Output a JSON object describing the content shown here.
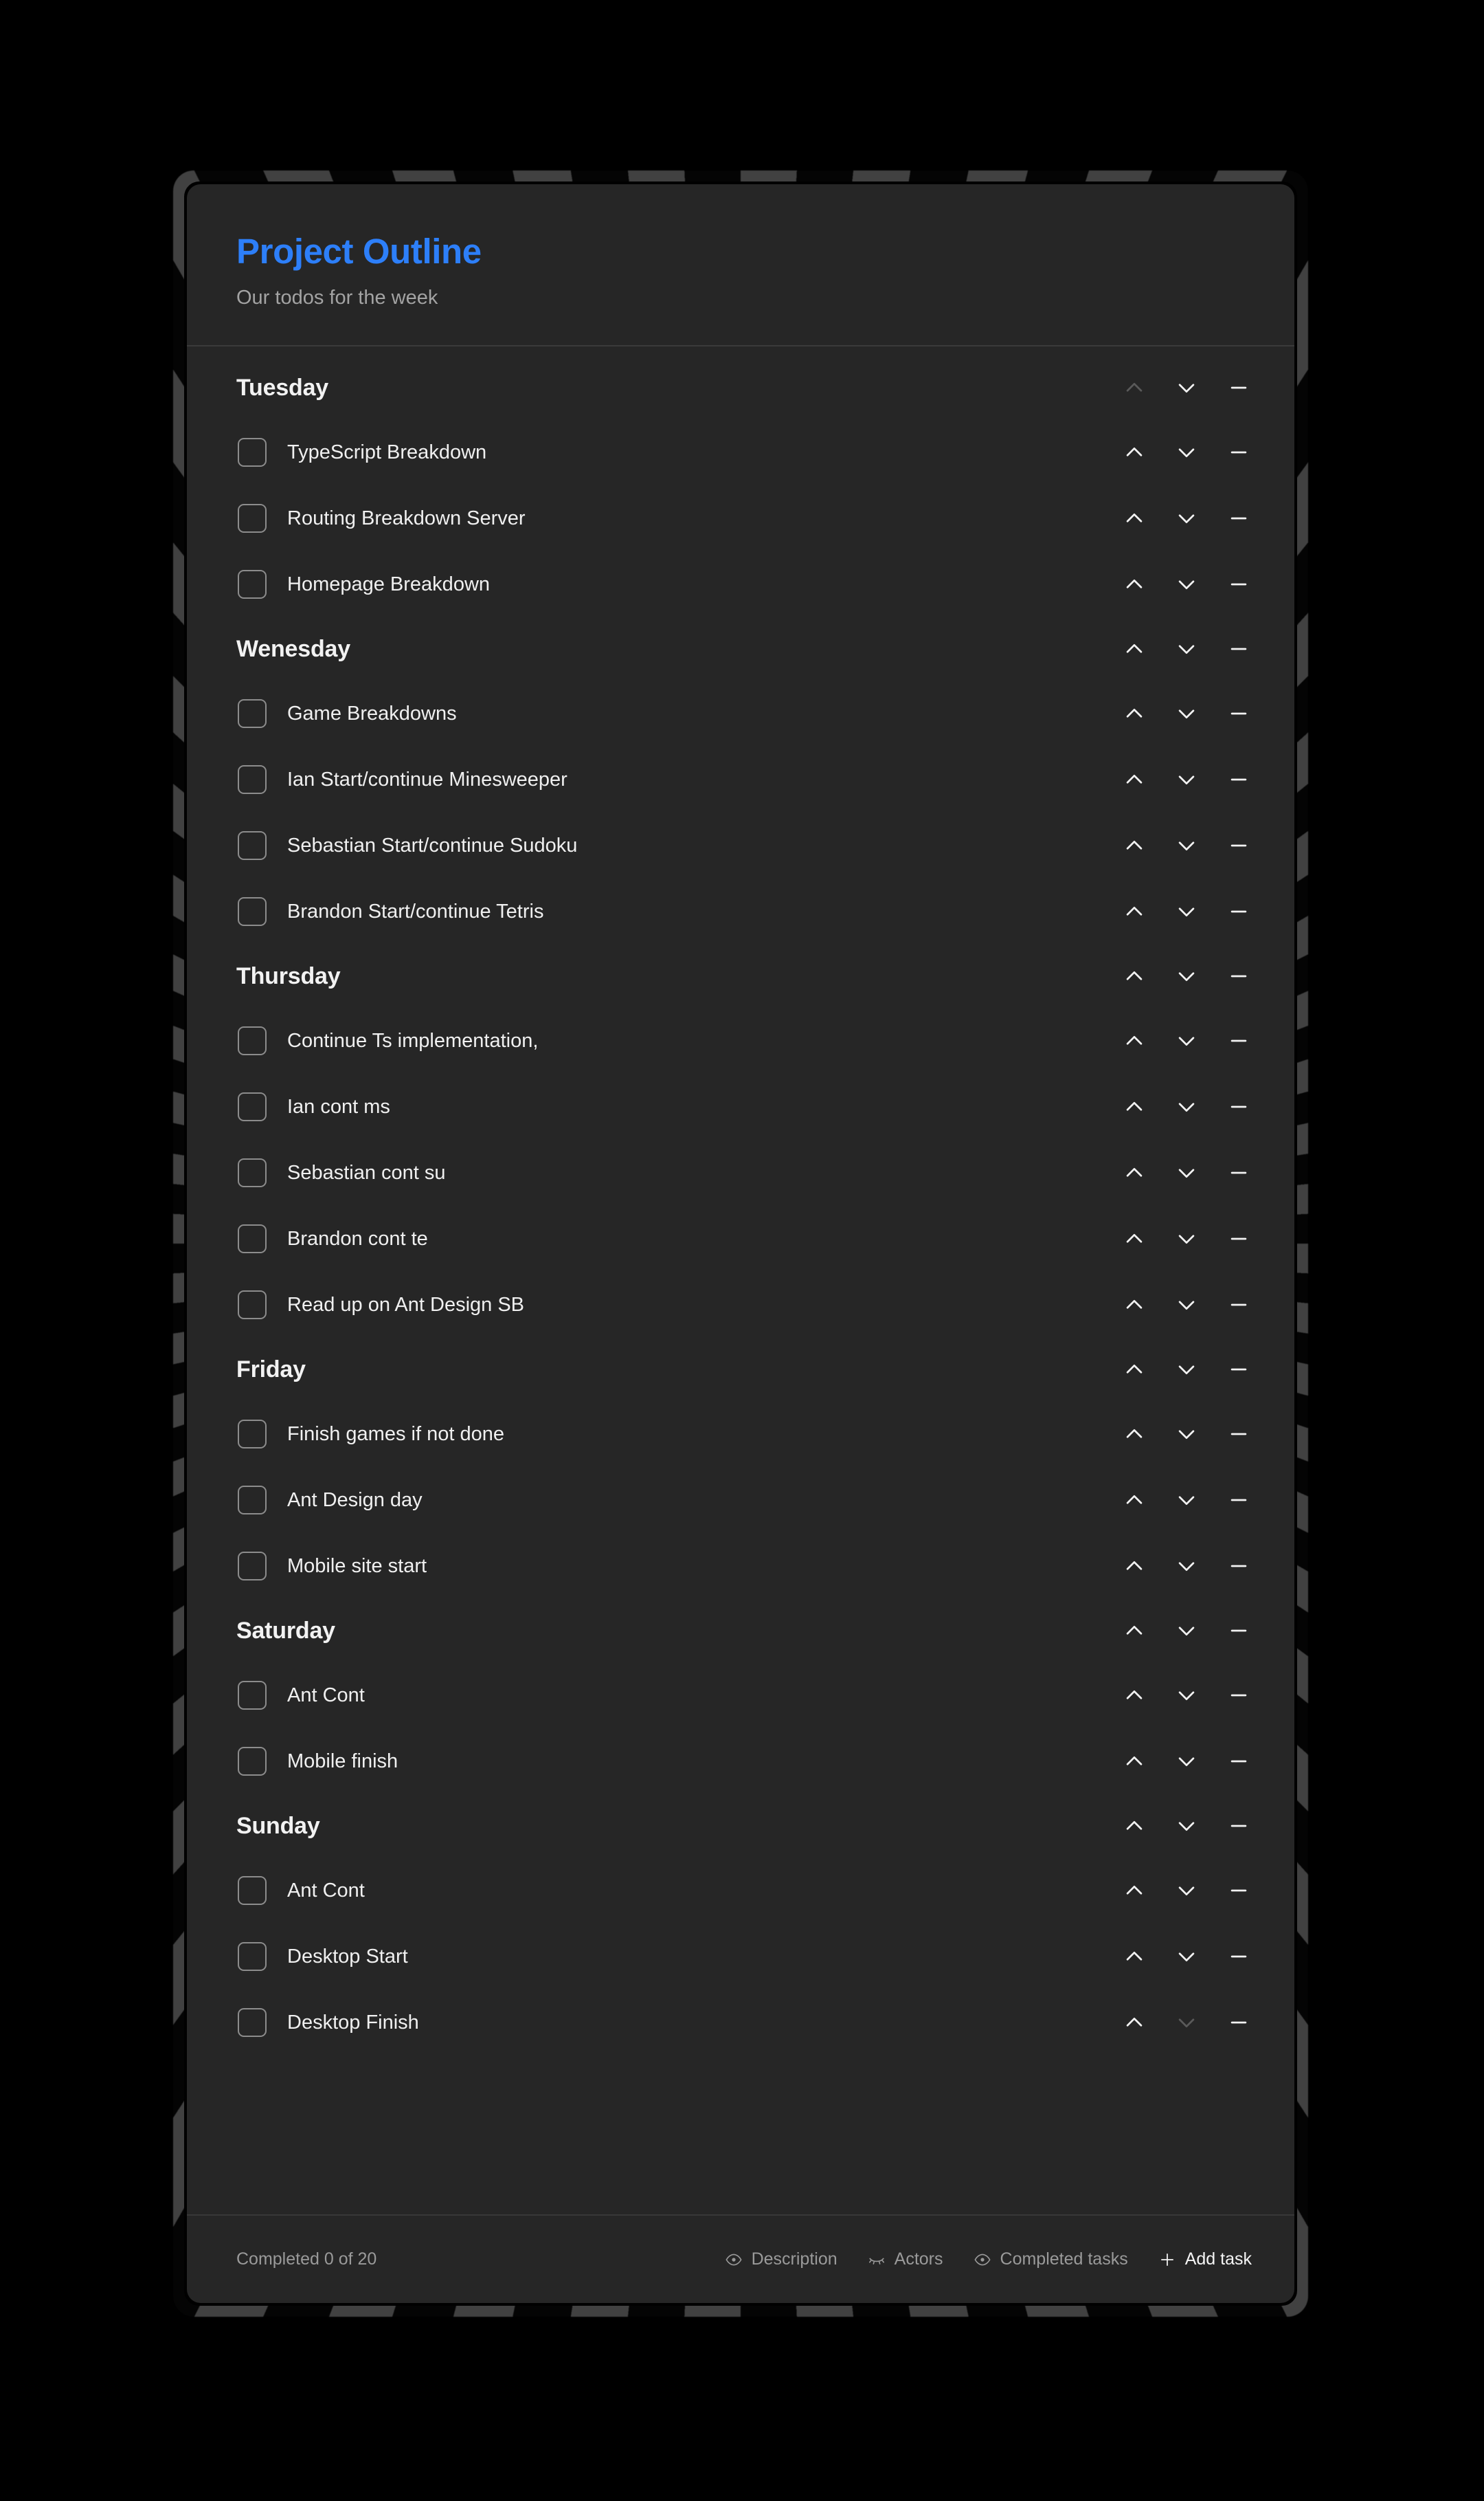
{
  "header": {
    "title": "Project Outline",
    "subtitle": "Our todos for the week",
    "title_color": "#2d7ff9"
  },
  "sections": [
    {
      "day": "Tuesday",
      "up_disabled": true,
      "down_disabled": false,
      "tasks": [
        {
          "label": "TypeScript Breakdown",
          "checked": false
        },
        {
          "label": "Routing Breakdown Server",
          "checked": false
        },
        {
          "label": "Homepage Breakdown",
          "checked": false
        }
      ]
    },
    {
      "day": "Wenesday",
      "up_disabled": false,
      "down_disabled": false,
      "tasks": [
        {
          "label": "Game Breakdowns",
          "checked": false
        },
        {
          "label": "Ian Start/continue Minesweeper",
          "checked": false
        },
        {
          "label": "Sebastian Start/continue Sudoku",
          "checked": false
        },
        {
          "label": "Brandon Start/continue Tetris",
          "checked": false
        }
      ]
    },
    {
      "day": "Thursday",
      "up_disabled": false,
      "down_disabled": false,
      "tasks": [
        {
          "label": "Continue Ts implementation,",
          "checked": false
        },
        {
          "label": "Ian cont ms",
          "checked": false
        },
        {
          "label": "Sebastian cont su",
          "checked": false
        },
        {
          "label": "Brandon cont te",
          "checked": false
        },
        {
          "label": "Read up on Ant Design SB",
          "checked": false
        }
      ]
    },
    {
      "day": "Friday",
      "up_disabled": false,
      "down_disabled": false,
      "tasks": [
        {
          "label": "Finish games if not done",
          "checked": false
        },
        {
          "label": "Ant Design day",
          "checked": false
        },
        {
          "label": "Mobile site start",
          "checked": false
        }
      ]
    },
    {
      "day": "Saturday",
      "up_disabled": false,
      "down_disabled": false,
      "tasks": [
        {
          "label": "Ant Cont",
          "checked": false
        },
        {
          "label": "Mobile finish",
          "checked": false
        }
      ]
    },
    {
      "day": "Sunday",
      "up_disabled": false,
      "down_disabled": false,
      "tasks": [
        {
          "label": "Ant Cont",
          "checked": false
        },
        {
          "label": "Desktop Start",
          "checked": false
        },
        {
          "label": "Desktop Finish",
          "checked": false,
          "down_disabled": true
        }
      ]
    }
  ],
  "row_controls": {
    "move_up": "chevron-up-icon",
    "move_down": "chevron-down-icon",
    "remove": "minus-icon"
  },
  "footer": {
    "completed_text": "Completed 0 of 20",
    "actions": [
      {
        "label": "Description",
        "icon": "eye-icon",
        "primary": false
      },
      {
        "label": "Actors",
        "icon": "eye-closed-icon",
        "primary": false
      },
      {
        "label": "Completed tasks",
        "icon": "eye-icon",
        "primary": false
      },
      {
        "label": "Add task",
        "icon": "plus-icon",
        "primary": true
      }
    ]
  }
}
